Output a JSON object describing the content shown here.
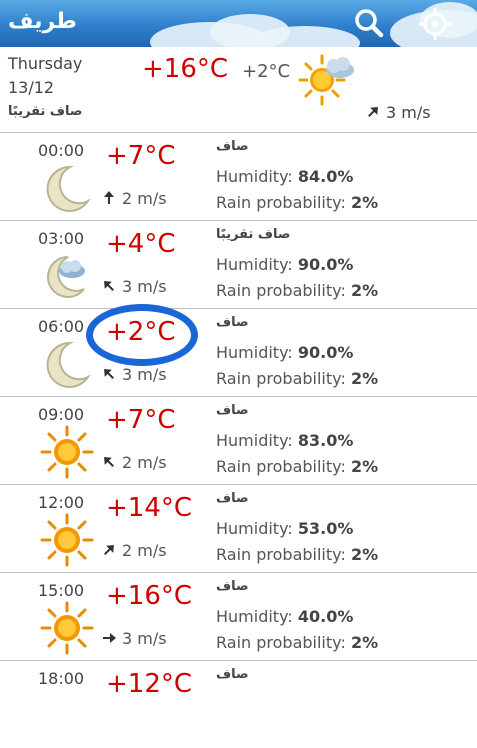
{
  "app": {
    "title": "طريف"
  },
  "summary": {
    "day": "Thursday",
    "date": "13/12",
    "condition": "صاف تقريبًا",
    "high": "+16°C",
    "low": "+2°C",
    "icon": "sun-cloud-icon",
    "wind": "3 m/s"
  },
  "labels": {
    "humidity": "Humidity:",
    "rain": "Rain probability:"
  },
  "rows": [
    {
      "time": "00:00",
      "temp": "+7°C",
      "wind": "2 m/s",
      "condition": "صاف",
      "humidity": "84.0%",
      "rain": "2%",
      "icon": "moon-icon"
    },
    {
      "time": "03:00",
      "temp": "+4°C",
      "wind": "3 m/s",
      "condition": "صاف تقريبًا",
      "humidity": "90.0%",
      "rain": "2%",
      "icon": "moon-cloud-icon"
    },
    {
      "time": "06:00",
      "temp": "+2°C",
      "wind": "3 m/s",
      "condition": "صاف",
      "humidity": "90.0%",
      "rain": "2%",
      "icon": "moon-icon"
    },
    {
      "time": "09:00",
      "temp": "+7°C",
      "wind": "2 m/s",
      "condition": "صاف",
      "humidity": "83.0%",
      "rain": "2%",
      "icon": "sun-icon"
    },
    {
      "time": "12:00",
      "temp": "+14°C",
      "wind": "2 m/s",
      "condition": "صاف",
      "humidity": "53.0%",
      "rain": "2%",
      "icon": "sun-icon"
    },
    {
      "time": "15:00",
      "temp": "+16°C",
      "wind": "3 m/s",
      "condition": "صاف",
      "humidity": "40.0%",
      "rain": "2%",
      "icon": "sun-icon"
    },
    {
      "time": "18:00",
      "temp": "+12°C",
      "condition": "صاف"
    }
  ]
}
